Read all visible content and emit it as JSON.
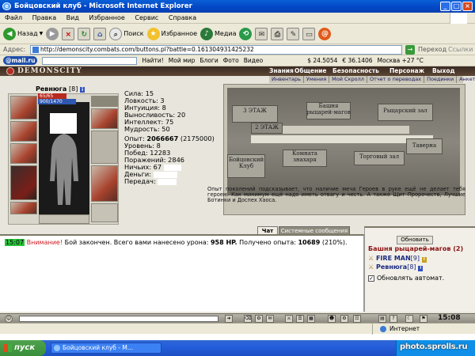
{
  "window": {
    "title": "Бойцовский клуб - Microsoft Internet Explorer"
  },
  "menu": [
    "Файл",
    "Правка",
    "Вид",
    "Избранное",
    "Сервис",
    "Справка"
  ],
  "toolbar": {
    "back": "Назад",
    "search": "Поиск",
    "favorites": "Избранное",
    "media": "Медиа"
  },
  "address": {
    "label": "Адрес:",
    "url": "http://demonscity.combats.com/buttons.pl?battle=0.161304931425232",
    "go": "Переход",
    "links": "Ссылки"
  },
  "mailru": {
    "logo": "@mail.ru",
    "find": "Найти!",
    "items": [
      "Мой мир",
      "Блоги",
      "Фото",
      "Видео"
    ],
    "usd": "$ 24.5054",
    "eur": "€ 36.1406",
    "weather": "Москва +27 °C"
  },
  "game": {
    "logo": "DEMONSCITY",
    "top_nav": [
      "Знания",
      "Общение",
      "Безопасность",
      "Персонаж",
      "Выход"
    ],
    "sub_nav": [
      "Инвентарь",
      "Умения",
      "Мой Скролл",
      "Отчет о переводах",
      "Поединки",
      "Анкета"
    ],
    "character": {
      "name": "Ревнюга",
      "level": "[8]",
      "badge": "i",
      "hp": "65/65",
      "mp": "900/1470"
    },
    "stats": [
      "Сила: 15",
      "Ловкость: 3",
      "Интуиция: 8",
      "Выносливость: 20",
      "Интеллект: 75",
      "Мудрость: 50"
    ],
    "record": {
      "experience_label": "Опыт:",
      "experience": "2066667",
      "experience_next": "(2175000)",
      "level": "Уровень: 8",
      "wins": "Побед: 12283",
      "losses": "Поражений: 2846",
      "draws": "Ничьих: 67",
      "money": "Деньги:",
      "transfers": "Передач:"
    },
    "map_zones": {
      "floor3": "3 ЭТАЖ",
      "knights_tower": "Башня рыцарей-магов",
      "knights_hall": "Рыцарский зал",
      "floor2": "2 ЭТАЖ",
      "tavern": "Таверна",
      "club": "Бойцовский Клуб",
      "healer": "Комната знахаря",
      "trade_hall": "Торговый зал"
    },
    "map_description": "Опыт поколений подсказывает, что наличие меча Героев в руке ещё не делает тебя героем. Как минимум ещё надо иметь отвагу и честь. А также Щит Пророчеств, Лучшие Ботинки и Доспех Хаоса."
  },
  "chat": {
    "tab_chat": "Чат",
    "tab_system": "Системные сообщения",
    "time": "15:07",
    "warning": "Внимание!",
    "message_prefix": "Бой закончен. Всего вами нанесено урона:",
    "damage": "958 HP.",
    "message_mid": "Получено опыта:",
    "exp": "10689",
    "exp_pct": "(210%)."
  },
  "who": {
    "refresh": "Обновить",
    "room": "Башня рыцарей-магов (2)",
    "players": [
      {
        "name": "FIRE MAN",
        "level": "[9]"
      },
      {
        "name": "Ревнюга",
        "level": "[8]"
      }
    ],
    "auto": "Обновлять автомат."
  },
  "bottombar": {
    "clock": "15:08"
  },
  "status": {
    "zone": "Интернет"
  },
  "taskbar": {
    "start": "пуск",
    "task": "Бойцовский клуб - M..."
  },
  "watermark": "photo.sprolls.ru"
}
